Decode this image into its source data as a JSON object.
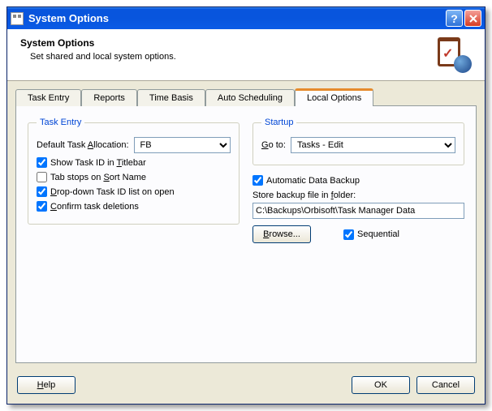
{
  "window": {
    "title": "System Options"
  },
  "header": {
    "title": "System Options",
    "subtitle": "Set shared and local system options."
  },
  "tabs": {
    "task_entry": "Task Entry",
    "reports": "Reports",
    "time_basis": "Time Basis",
    "auto_scheduling": "Auto Scheduling",
    "local_options": "Local Options"
  },
  "task_entry_group": {
    "legend": "Task Entry",
    "default_alloc_label_pre": "Default Task ",
    "default_alloc_label_u": "A",
    "default_alloc_label_post": "llocation:",
    "default_alloc_value": "FB",
    "show_task_id_pre": "Show Task ID in ",
    "show_task_id_u": "T",
    "show_task_id_post": "itlebar",
    "show_task_id_checked": true,
    "tab_stops_pre": "Tab stops on ",
    "tab_stops_u": "S",
    "tab_stops_post": "ort Name",
    "tab_stops_checked": false,
    "dropdown_pre": "",
    "dropdown_u": "D",
    "dropdown_post": "rop-down Task ID list on open",
    "dropdown_checked": true,
    "confirm_pre": "",
    "confirm_u": "C",
    "confirm_post": "onfirm task deletions",
    "confirm_checked": true
  },
  "startup_group": {
    "legend": "Startup",
    "goto_u": "G",
    "goto_post": "o to:",
    "goto_value": "Tasks - Edit"
  },
  "backup_group": {
    "auto_backup_label": "Automatic Data Backup",
    "auto_backup_checked": true,
    "store_label_pre": "Store backup file in ",
    "store_label_u": "f",
    "store_label_post": "older:",
    "path": "C:\\Backups\\Orbisoft\\Task Manager Data",
    "browse_u": "B",
    "browse_post": "rowse...",
    "sequential_label": "Sequential",
    "sequential_checked": true
  },
  "footer": {
    "help_u": "H",
    "help_post": "elp",
    "ok": "OK",
    "cancel": "Cancel"
  }
}
